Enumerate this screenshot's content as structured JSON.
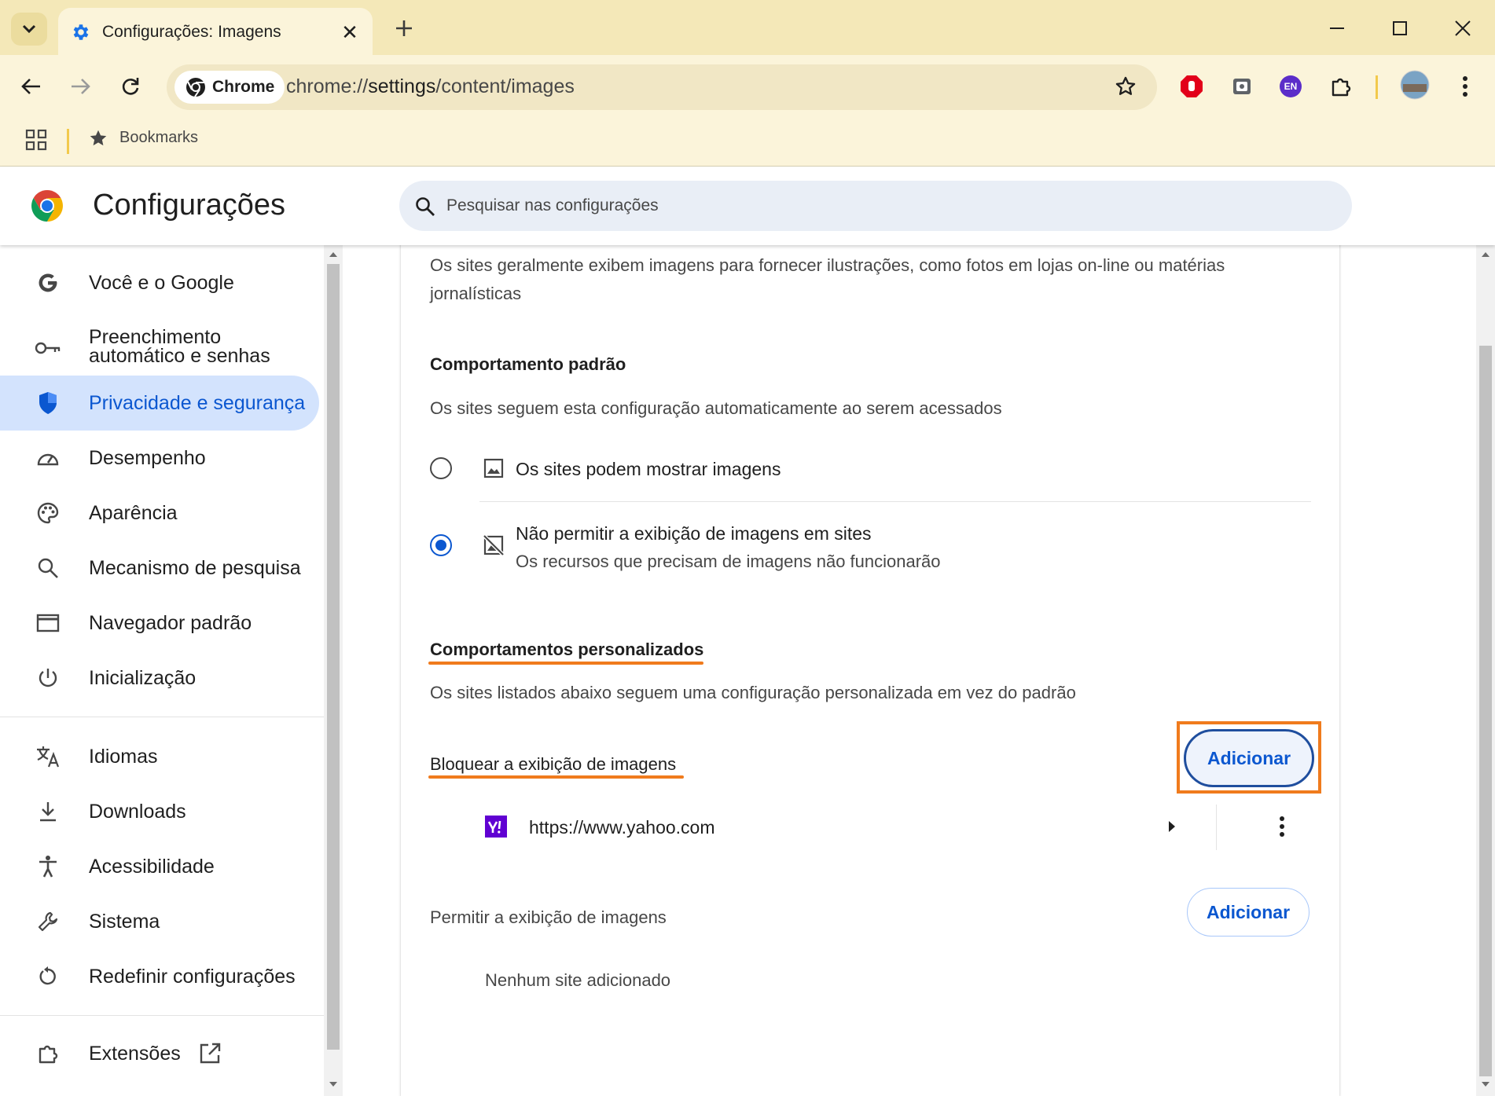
{
  "window": {
    "tab_title": "Configurações: Imagens"
  },
  "toolbar": {
    "chip_label": "Chrome",
    "url_prefix": "chrome://",
    "url_host": "settings",
    "url_path": "/content/images",
    "extension_badge": "EN"
  },
  "bookmarks_bar": {
    "label": "Bookmarks"
  },
  "settings": {
    "title": "Configurações",
    "search_placeholder": "Pesquisar nas configurações"
  },
  "sidebar": {
    "items": [
      {
        "label": "Você e o Google",
        "icon": "google-icon"
      },
      {
        "label": "Preenchimento",
        "label2": "automático e senhas",
        "icon": "key-icon"
      },
      {
        "label": "Privacidade e segurança",
        "icon": "shield-icon",
        "active": true
      },
      {
        "label": "Desempenho",
        "icon": "speedometer-icon"
      },
      {
        "label": "Aparência",
        "icon": "palette-icon"
      },
      {
        "label": "Mecanismo de pesquisa",
        "icon": "search-icon"
      },
      {
        "label": "Navegador padrão",
        "icon": "browser-window-icon"
      },
      {
        "label": "Inicialização",
        "icon": "power-icon"
      },
      {
        "label": "Idiomas",
        "icon": "translate-icon"
      },
      {
        "label": "Downloads",
        "icon": "download-icon"
      },
      {
        "label": "Acessibilidade",
        "icon": "accessibility-icon"
      },
      {
        "label": "Sistema",
        "icon": "wrench-icon"
      },
      {
        "label": "Redefinir configurações",
        "icon": "reset-icon"
      },
      {
        "label": "Extensões",
        "icon": "puzzle-icon"
      }
    ]
  },
  "content": {
    "intro_line1": "Os sites geralmente exibem imagens para fornecer ilustrações, como fotos em lojas on-line ou matérias",
    "intro_line2": "jornalísticas",
    "default_heading": "Comportamento padrão",
    "default_desc": "Os sites seguem esta configuração automaticamente ao serem acessados",
    "option_allow": "Os sites podem mostrar imagens",
    "option_block": "Não permitir a exibição de imagens em sites",
    "option_block_sub": "Os recursos que precisam de imagens não funcionarão",
    "selected_option": "block",
    "custom_heading": "Comportamentos personalizados",
    "custom_desc": "Os sites listados abaixo seguem uma configuração personalizada em vez do padrão",
    "block_heading": "Bloquear a exibição de imagens",
    "add_label": "Adicionar",
    "blocked_sites": [
      "https://www.yahoo.com"
    ],
    "allow_heading": "Permitir a exibição de imagens",
    "allow_empty": "Nenhum site adicionado"
  },
  "colors": {
    "accent": "#0b57d0",
    "highlight": "#f07b1d",
    "titlebar": "#f4e8b8",
    "toolbar": "#fbf4da"
  }
}
